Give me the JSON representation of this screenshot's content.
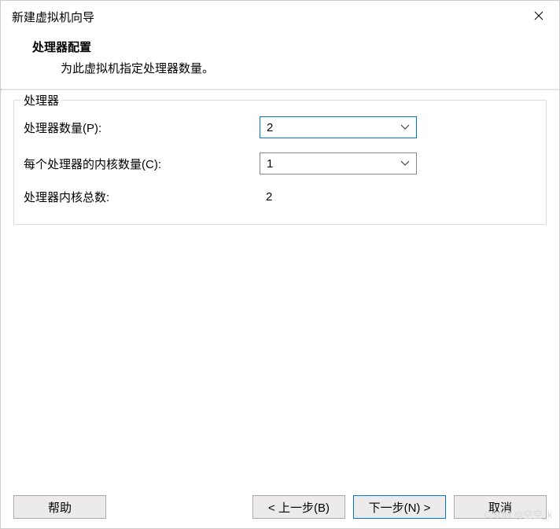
{
  "window": {
    "title": "新建虚拟机向导"
  },
  "header": {
    "title": "处理器配置",
    "description": "为此虚拟机指定处理器数量。"
  },
  "group": {
    "label": "处理器",
    "processor_count": {
      "label": "处理器数量(P):",
      "value": "2"
    },
    "cores_per_processor": {
      "label": "每个处理器的内核数量(C):",
      "value": "1"
    },
    "total_cores": {
      "label": "处理器内核总数:",
      "value": "2"
    }
  },
  "buttons": {
    "help": "帮助",
    "back": "< 上一步(B)",
    "next": "下一步(N) >",
    "cancel": "取消"
  },
  "watermark": "CSDN @空空_k"
}
